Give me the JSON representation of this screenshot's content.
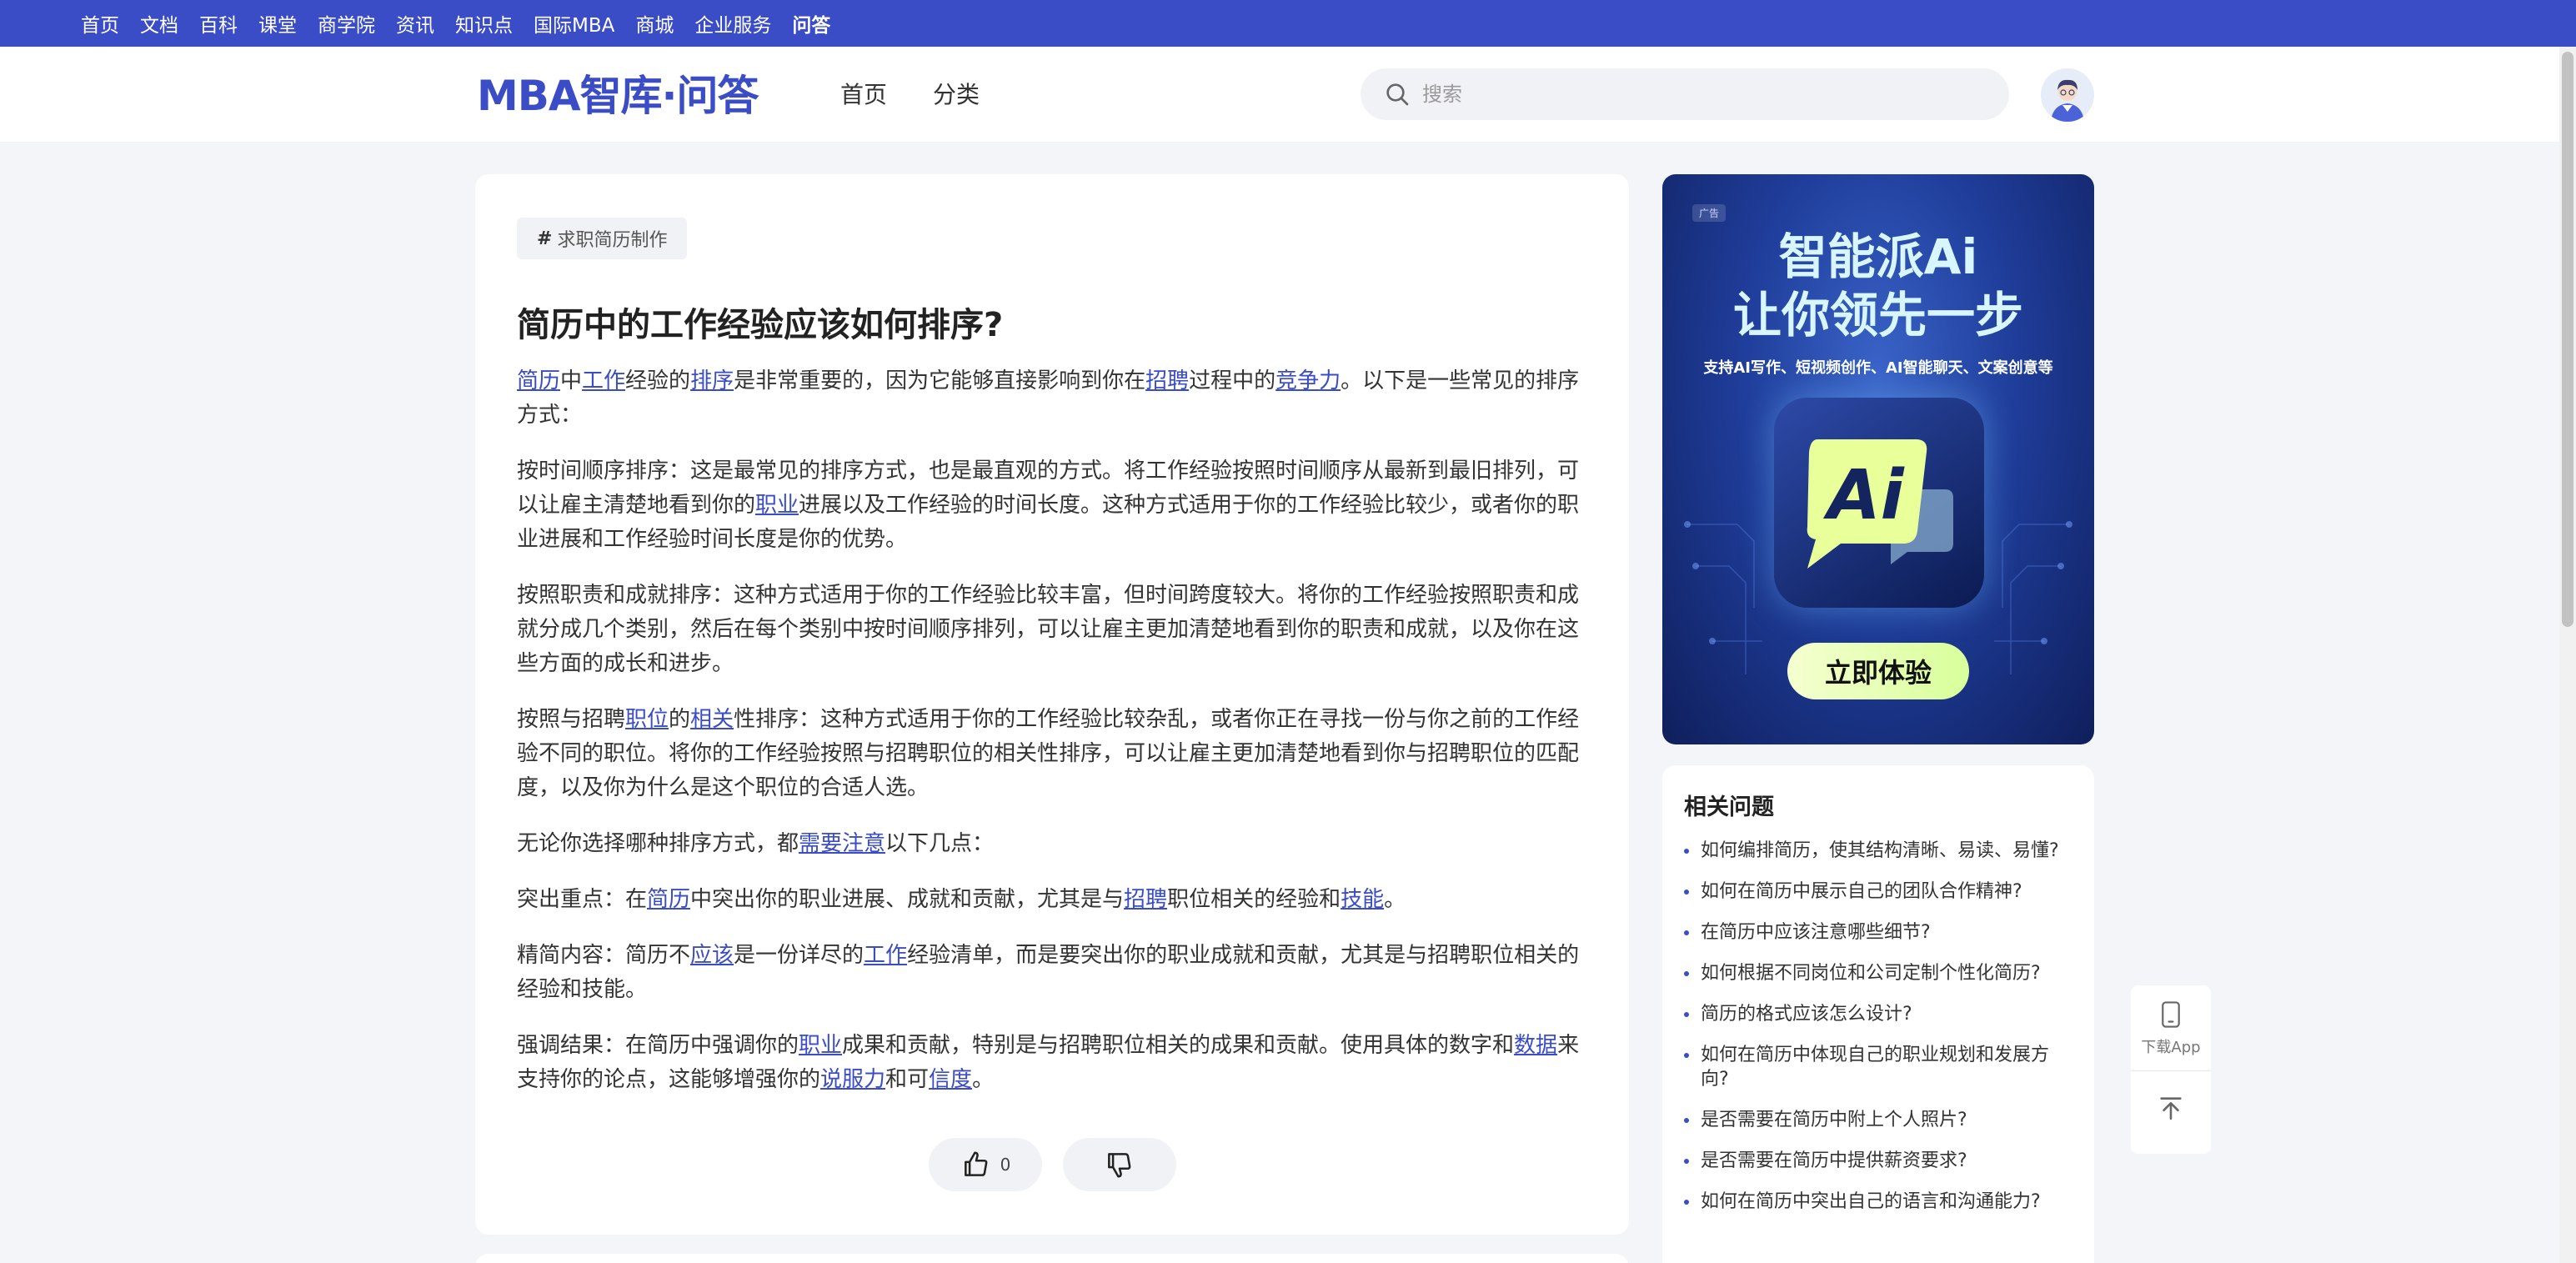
{
  "topnav": {
    "items": [
      "首页",
      "文档",
      "百科",
      "课堂",
      "商学院",
      "资讯",
      "知识点",
      "国际MBA",
      "商城",
      "企业服务",
      "问答"
    ],
    "active": "问答"
  },
  "header": {
    "logo": "MBA智库·问答",
    "nav": [
      "首页",
      "分类"
    ],
    "search_placeholder": "搜索"
  },
  "question": {
    "tag": "求职简历制作",
    "title": "简历中的工作经验应该如何排序?",
    "paragraphs": [
      [
        {
          "t": "简历",
          "k": 1
        },
        {
          "t": "中"
        },
        {
          "t": "工作",
          "k": 1
        },
        {
          "t": "经验的"
        },
        {
          "t": "排序",
          "k": 1
        },
        {
          "t": "是非常重要的，因为它能够直接影响到你在"
        },
        {
          "t": "招聘",
          "k": 1
        },
        {
          "t": "过程中的"
        },
        {
          "t": "竞争力",
          "k": 1
        },
        {
          "t": "。以下是一些常见的排序方式："
        }
      ],
      [
        {
          "t": "按时间顺序排序：这是最常见的排序方式，也是最直观的方式。将工作经验按照时间顺序从最新到最旧排列，可以让雇主清楚地看到你的"
        },
        {
          "t": "职业",
          "k": 1
        },
        {
          "t": "进展以及工作经验的时间长度。这种方式适用于你的工作经验比较少，或者你的职业进展和工作经验时间长度是你的优势。"
        }
      ],
      [
        {
          "t": "按照职责和成就排序：这种方式适用于你的工作经验比较丰富，但时间跨度较大。将你的工作经验按照职责和成就分成几个类别，然后在每个类别中按时间顺序排列，可以让雇主更加清楚地看到你的职责和成就，以及你在这些方面的成长和进步。"
        }
      ],
      [
        {
          "t": "按照与招聘"
        },
        {
          "t": "职位",
          "k": 1
        },
        {
          "t": "的"
        },
        {
          "t": "相关",
          "k": 1
        },
        {
          "t": "性排序：这种方式适用于你的工作经验比较杂乱，或者你正在寻找一份与你之前的工作经验不同的职位。将你的工作经验按照与招聘职位的相关性排序，可以让雇主更加清楚地看到你与招聘职位的匹配度，以及你为什么是这个职位的合适人选。"
        }
      ],
      [
        {
          "t": "无论你选择哪种排序方式，都"
        },
        {
          "t": "需要注意",
          "k": 1
        },
        {
          "t": "以下几点："
        }
      ],
      [
        {
          "t": "突出重点：在"
        },
        {
          "t": "简历",
          "k": 1
        },
        {
          "t": "中突出你的职业进展、成就和贡献，尤其是与"
        },
        {
          "t": "招聘",
          "k": 1
        },
        {
          "t": "职位相关的经验和"
        },
        {
          "t": "技能",
          "k": 1
        },
        {
          "t": "。"
        }
      ],
      [
        {
          "t": "精简内容：简历不"
        },
        {
          "t": "应该",
          "k": 1
        },
        {
          "t": "是一份详尽的"
        },
        {
          "t": "工作",
          "k": 1
        },
        {
          "t": "经验清单，而是要突出你的职业成就和贡献，尤其是与招聘职位相关的经验和技能。"
        }
      ],
      [
        {
          "t": "强调结果：在简历中强调你的"
        },
        {
          "t": "职业",
          "k": 1
        },
        {
          "t": "成果和贡献，特别是与招聘职位相关的成果和贡献。使用具体的数字和"
        },
        {
          "t": "数据",
          "k": 1
        },
        {
          "t": "来支持你的论点，这能够增强你的"
        },
        {
          "t": "说服力",
          "k": 1
        },
        {
          "t": "和可"
        },
        {
          "t": "信度",
          "k": 1
        },
        {
          "t": "。"
        }
      ]
    ],
    "like_count": "0"
  },
  "ad": {
    "label": "广告",
    "title_line1": "智能派Ai",
    "title_line2": "让你领先一步",
    "subtitle": "支持AI写作、短视频创作、AI智能聊天、文案创意等",
    "icon_text": "Ai",
    "button": "立即体验"
  },
  "related": {
    "title": "相关问题",
    "items": [
      "如何编排简历，使其结构清晰、易读、易懂?",
      "如何在简历中展示自己的团队合作精神?",
      "在简历中应该注意哪些细节?",
      "如何根据不同岗位和公司定制个性化简历?",
      "简历的格式应该怎么设计?",
      "如何在简历中体现自己的职业规划和发展方向?",
      "是否需要在简历中附上个人照片?",
      "是否需要在简历中提供薪资要求?",
      "如何在简历中突出自己的语言和沟通能力?"
    ]
  },
  "float": {
    "download": "下载App"
  },
  "colors": {
    "brand": "#3a4cc6",
    "background": "#f3f5f9"
  }
}
